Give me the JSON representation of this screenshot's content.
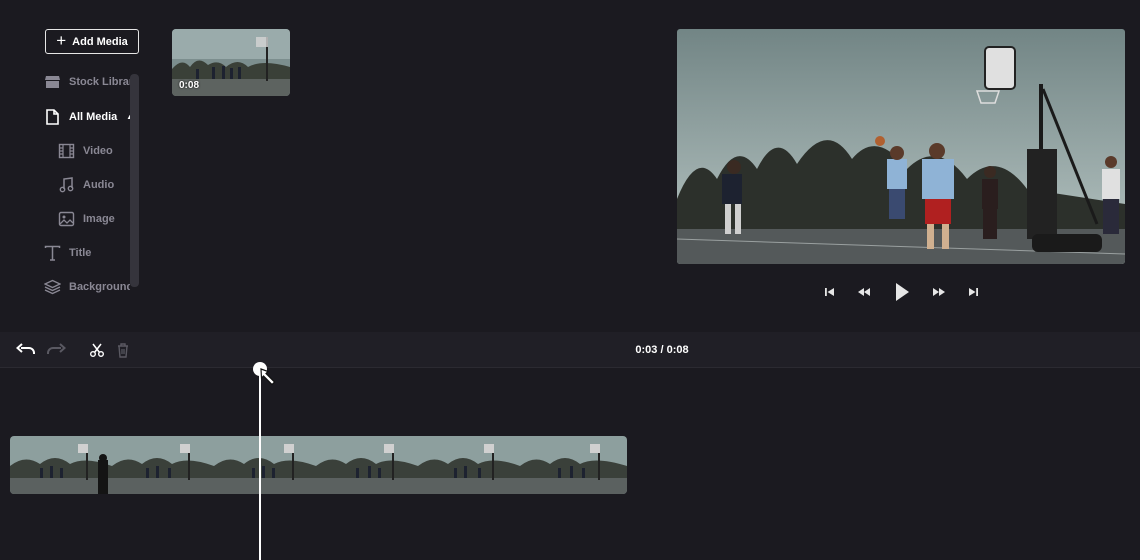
{
  "sidebar": {
    "add_media_label": "Add Media",
    "items": [
      {
        "label": "Stock Library",
        "icon": "store-icon"
      },
      {
        "label": "All Media",
        "icon": "file-icon",
        "active": true,
        "caret": "▲"
      },
      {
        "label": "Video",
        "icon": "film-icon"
      },
      {
        "label": "Audio",
        "icon": "music-note-icon"
      },
      {
        "label": "Image",
        "icon": "image-icon"
      },
      {
        "label": "Title",
        "icon": "text-icon"
      },
      {
        "label": "Background",
        "icon": "layers-icon"
      }
    ]
  },
  "media_library": {
    "items": [
      {
        "duration": "0:08",
        "kind": "video"
      }
    ]
  },
  "preview": {
    "controls": [
      "skip-to-start-icon",
      "rewind-icon",
      "play-icon",
      "fast-forward-icon",
      "skip-to-end-icon"
    ]
  },
  "timeline": {
    "tools": [
      "undo-icon",
      "redo-icon",
      "split-icon",
      "trash-icon"
    ],
    "current_time": "0:03",
    "total_time": "0:08",
    "time_display": "0:03 / 0:08",
    "clip_frame_count": 6
  },
  "colors": {
    "background": "#1b1a20",
    "toolbar": "#201f26",
    "text_active": "#ffffff",
    "text_muted": "#8a8894",
    "playhead": "#ffffff"
  }
}
